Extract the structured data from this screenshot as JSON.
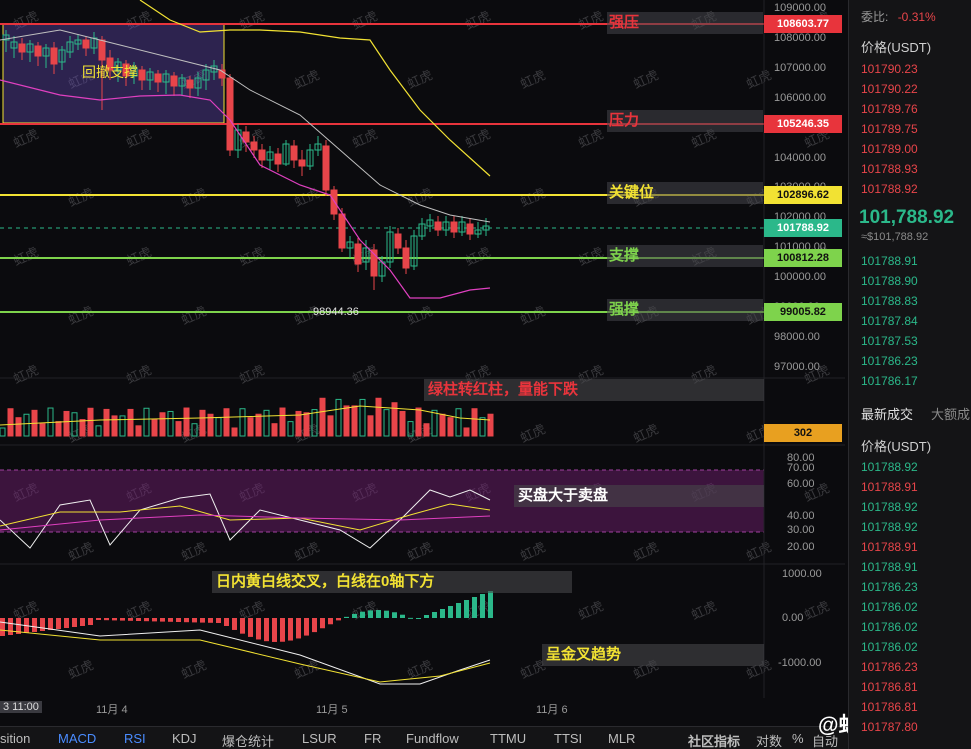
{
  "price_levels": [
    {
      "id": "strong-resistance",
      "label": "强压",
      "price": "108603.77",
      "color": "#e8343c",
      "text_color": "#e8343c"
    },
    {
      "id": "resistance",
      "label": "压力",
      "price": "105246.35",
      "color": "#e8343c",
      "text_color": "#e8343c"
    },
    {
      "id": "key-level",
      "label": "关键位",
      "price": "102896.62",
      "color": "#f2e233",
      "text_color": "#f2e233"
    },
    {
      "id": "support",
      "label": "支撑",
      "price": "100812.28",
      "color": "#7ed34c",
      "text_color": "#7ed34c"
    },
    {
      "id": "strong-support",
      "label": "强撑",
      "price": "99005.82",
      "color": "#7ed34c",
      "text_color": "#7ed34c"
    }
  ],
  "current_price_tag": "101788.92",
  "price_axis": [
    "109000.00",
    "108000.00",
    "107000.00",
    "106000.00",
    "105000.00",
    "104000.00",
    "103000.00",
    "102000.00",
    "101000.00",
    "100000.00",
    "99000.00",
    "98000.00",
    "97000.00"
  ],
  "range_box_label": "回撤支撑",
  "low_marker": "98944.36",
  "watermark": "虹虎",
  "volume_note": "绿柱转红柱，量能下跌",
  "volume_value": "302",
  "rsi_note": "买盘大于卖盘",
  "rsi_axis": [
    "80.00",
    "70.00",
    "60.00",
    "40.00",
    "30.00",
    "20.00"
  ],
  "macd_note": "日内黄白线交叉，白线在0轴下方",
  "macd_note2": "呈金叉趋势",
  "macd_axis": [
    "1000.00",
    "0.00",
    "-1000.00"
  ],
  "time_axis": {
    "cursor": "3 11:00",
    "labels": [
      "11月 4",
      "11月 5",
      "11月 6"
    ]
  },
  "bottom_tabs": [
    "sition",
    "MACD",
    "RSI",
    "KDJ",
    "爆仓统计",
    "LSUR",
    "FR",
    "Fundflow",
    "TTMU",
    "TTSI",
    "MLR",
    "社区指标",
    "对数",
    "%",
    "自动"
  ],
  "brand": "@虹虎趋势",
  "right_panel": {
    "ratio_label": "委比:",
    "ratio_value": "-0.31%",
    "header": "价格(USDT)",
    "asks": [
      "101790.23",
      "101790.22",
      "101789.76",
      "101789.75",
      "101789.00",
      "101788.93",
      "101788.92"
    ],
    "last_price": "101,788.92",
    "last_price_sub": "≈$101,788.92",
    "bids": [
      "101788.91",
      "101788.90",
      "101788.83",
      "101787.84",
      "101787.53",
      "101786.23",
      "101786.17"
    ],
    "trades_tab": "最新成交",
    "trades_tab2": "大额成",
    "trades_header": "价格(USDT)",
    "trades": [
      {
        "p": "101788.92",
        "side": "buy"
      },
      {
        "p": "101788.91",
        "side": "sell"
      },
      {
        "p": "101788.92",
        "side": "buy"
      },
      {
        "p": "101788.92",
        "side": "buy"
      },
      {
        "p": "101788.91",
        "side": "sell"
      },
      {
        "p": "101788.91",
        "side": "buy"
      },
      {
        "p": "101786.23",
        "side": "buy"
      },
      {
        "p": "101786.02",
        "side": "buy"
      },
      {
        "p": "101786.02",
        "side": "buy"
      },
      {
        "p": "101786.02",
        "side": "buy"
      },
      {
        "p": "101786.23",
        "side": "sell"
      },
      {
        "p": "101786.81",
        "side": "sell"
      },
      {
        "p": "101786.81",
        "side": "sell"
      },
      {
        "p": "101787.80",
        "side": "sell"
      }
    ]
  },
  "colors": {
    "up": "#2bb88a",
    "down": "#e8454a",
    "bg": "#0b0b0e"
  }
}
